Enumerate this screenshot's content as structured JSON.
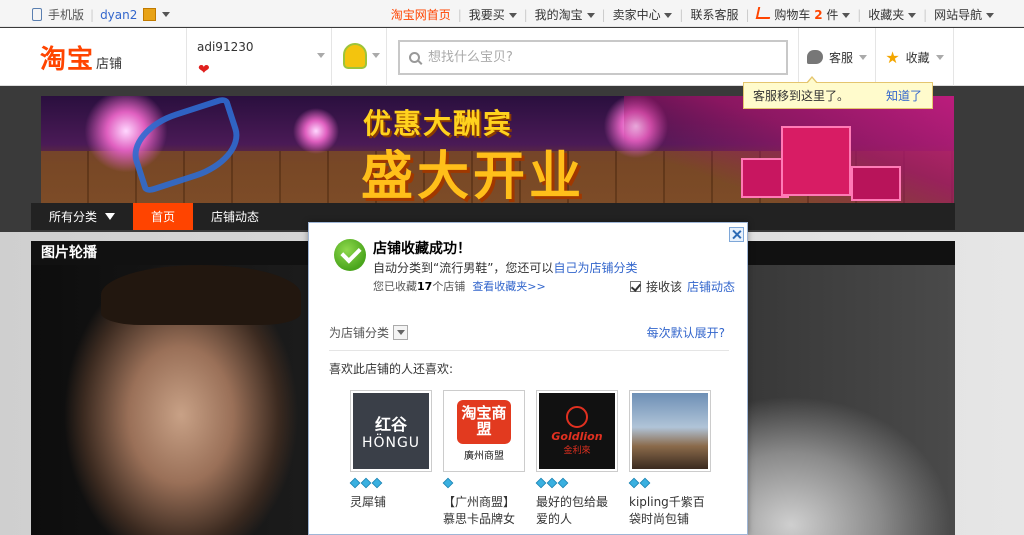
{
  "topbar": {
    "mobile_label": "手机版",
    "username": "dyan2",
    "links": [
      "淘宝网首页",
      "我要买",
      "我的淘宝",
      "卖家中心",
      "联系客服",
      "购物车",
      "收藏夹",
      "网站导航"
    ],
    "cart_count": "2",
    "cart_unit": "件"
  },
  "header": {
    "logo_main": "淘宝",
    "logo_sub": "店铺",
    "seller_name": "adi91230",
    "search_placeholder": "想找什么宝贝?",
    "service_label": "客服",
    "favorite_label": "收藏"
  },
  "tooltip": {
    "text": "客服移到这里了。",
    "ok_label": "知道了"
  },
  "banner": {
    "line1": "优惠大酬宾",
    "line2": "盛大开业"
  },
  "shop_nav": {
    "items": [
      "所有分类",
      "首页",
      "店铺动态"
    ],
    "active_index": 1
  },
  "gallery": {
    "title": "图片轮播"
  },
  "dialog": {
    "title": "店铺收藏成功！",
    "line1_prefix": "自动分类到“流行男鞋”，您还可以",
    "line1_link": "自己为店铺分类",
    "line2_prefix": "您已收藏",
    "line2_count": "17",
    "line2_suffix": "个店铺",
    "line2_link": "查看收藏夹>>",
    "subscribe_prefix": "接收该",
    "subscribe_link": "店铺动态",
    "subscribe_checked": true,
    "category_label": "为店铺分类",
    "expand_label": "每次默认展开?",
    "also_like_label": "喜欢此店铺的人还喜欢:",
    "products": [
      {
        "name_line1": "灵犀铺",
        "name_line2": "",
        "logo_a": "红谷",
        "logo_b": "HÖNGU",
        "diamonds": 3
      },
      {
        "name_line1": "【广州商盟】",
        "name_line2": "慕思卡品牌女",
        "logo_a": "淘宝商盟",
        "logo_b": "廣州商盟",
        "diamonds": 1
      },
      {
        "name_line1": "最好的包给最",
        "name_line2": "爱的人",
        "logo_a": "Goldlion",
        "logo_b": "金利來",
        "diamonds": 3
      },
      {
        "name_line1": "kipling千紫百",
        "name_line2": "袋时尚包铺",
        "logo_a": "",
        "logo_b": "",
        "diamonds": 2
      }
    ]
  }
}
